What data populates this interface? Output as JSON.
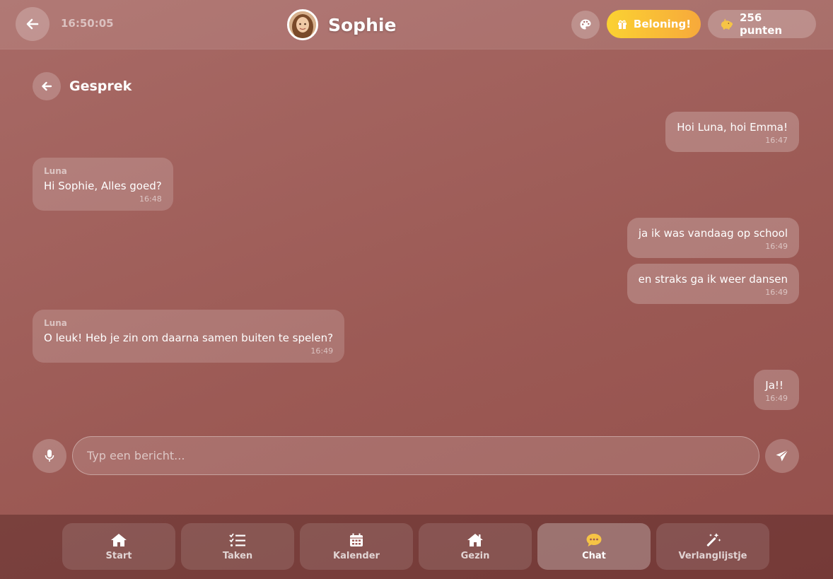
{
  "header": {
    "time": "16:50:05",
    "profile_name": "Sophie",
    "reward_label": "Beloning!",
    "points_label": "256 punten"
  },
  "conversation": {
    "title": "Gesprek",
    "messages": [
      {
        "sender": "",
        "mine": true,
        "text": "Hoi Luna, hoi Emma!",
        "time": "16:47"
      },
      {
        "sender": "Luna",
        "mine": false,
        "text": "Hi Sophie, Alles goed?",
        "time": "16:48"
      },
      {
        "sender": "",
        "mine": true,
        "text": "ja ik was vandaag op school",
        "time": "16:49"
      },
      {
        "sender": "",
        "mine": true,
        "text": "en straks ga ik weer dansen",
        "time": "16:49"
      },
      {
        "sender": "Luna",
        "mine": false,
        "text": "O leuk! Heb je zin om daarna samen buiten te spelen?",
        "time": "16:49"
      },
      {
        "sender": "",
        "mine": true,
        "text": "Ja!!",
        "time": "16:49"
      }
    ]
  },
  "composer": {
    "placeholder": "Typ een bericht..."
  },
  "nav": {
    "items": [
      {
        "label": "Start",
        "icon": "home-icon"
      },
      {
        "label": "Taken",
        "icon": "checklist-icon"
      },
      {
        "label": "Kalender",
        "icon": "calendar-icon"
      },
      {
        "label": "Gezin",
        "icon": "family-home-icon"
      },
      {
        "label": "Chat",
        "icon": "chat-bubble-icon",
        "active": true
      },
      {
        "label": "Verlanglijstje",
        "icon": "magic-wand-icon"
      }
    ]
  },
  "colors": {
    "background": "#9e5c57",
    "reward_gradient_start": "#fbd232",
    "reward_gradient_end": "#f7a93b",
    "chat_icon_accent": "#f6c445"
  }
}
